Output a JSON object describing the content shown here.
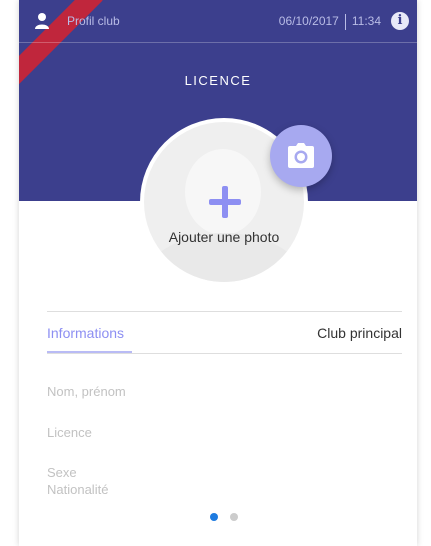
{
  "header": {
    "profile_link": "Profil club",
    "date": "06/10/2017",
    "time": "11:34",
    "info_icon": "info-icon",
    "title": "LICENCE",
    "colors": {
      "header_bg": "#3c3f8d",
      "ribbon": "#c0263c",
      "accent": "#8d8ff2"
    }
  },
  "photo": {
    "add_label": "Ajouter une photo",
    "plus_icon": "plus-icon",
    "camera_icon": "camera-icon"
  },
  "tabs": [
    {
      "label": "Informations",
      "active": true
    },
    {
      "label": "Club principal",
      "active": false
    }
  ],
  "fields": {
    "name": "Nom, prénom",
    "licence": "Licence",
    "sexe": "Sexe",
    "nationalite": "Nationalité"
  },
  "pagination": {
    "pages": 2,
    "current": 1,
    "active_color": "#1e7be0",
    "inactive_color": "#cccccc"
  }
}
